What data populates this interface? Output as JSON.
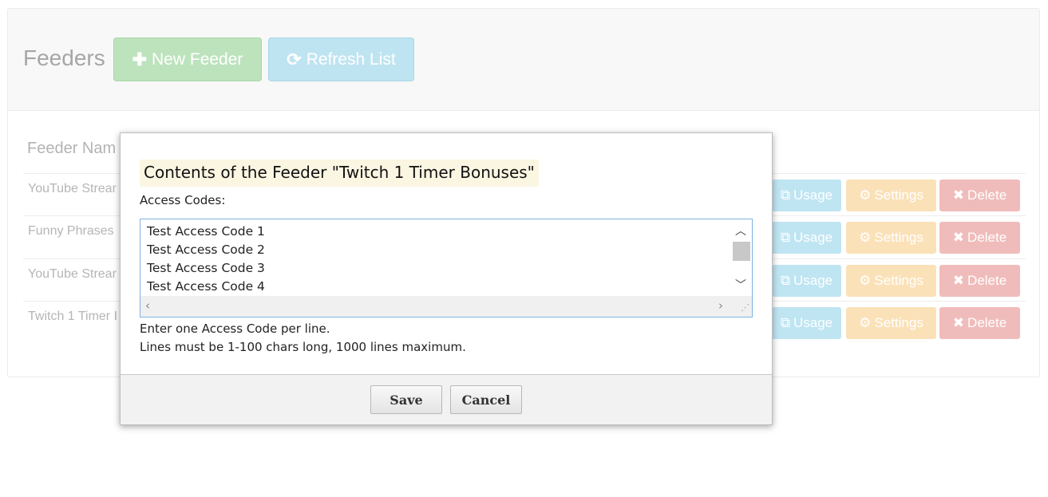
{
  "header": {
    "title": "Feeders",
    "new_feeder_label": "New Feeder",
    "refresh_label": "Refresh List"
  },
  "table": {
    "column_name_header": "Feeder Nam",
    "rows": [
      {
        "name": "YouTube Strear"
      },
      {
        "name": "Funny Phrases"
      },
      {
        "name": "YouTube Strear"
      },
      {
        "name": "Twitch 1 Timer I"
      }
    ],
    "usage_label": "Usage",
    "settings_label": "Settings",
    "delete_label": "Delete"
  },
  "modal": {
    "title": "Contents of the Feeder \"Twitch 1 Timer Bonuses\"",
    "field_label": "Access Codes:",
    "lines": [
      "Test Access Code 1",
      "Test Access Code 2",
      "Test Access Code 3",
      "Test Access Code 4"
    ],
    "hint_1": "Enter one Access Code per line.",
    "hint_2": "Lines must be 1-100 chars long, 1000 lines maximum.",
    "save_label": "Save",
    "cancel_label": "Cancel"
  },
  "colors": {
    "success": "#5cb85c",
    "info": "#5bc0de",
    "warning": "#f0ad4e",
    "danger": "#d9534f"
  },
  "icons": {
    "new_feeder": "plus-icon",
    "refresh": "refresh-icon",
    "usage": "external-link-icon",
    "settings": "gear-icon",
    "delete": "close-icon"
  }
}
